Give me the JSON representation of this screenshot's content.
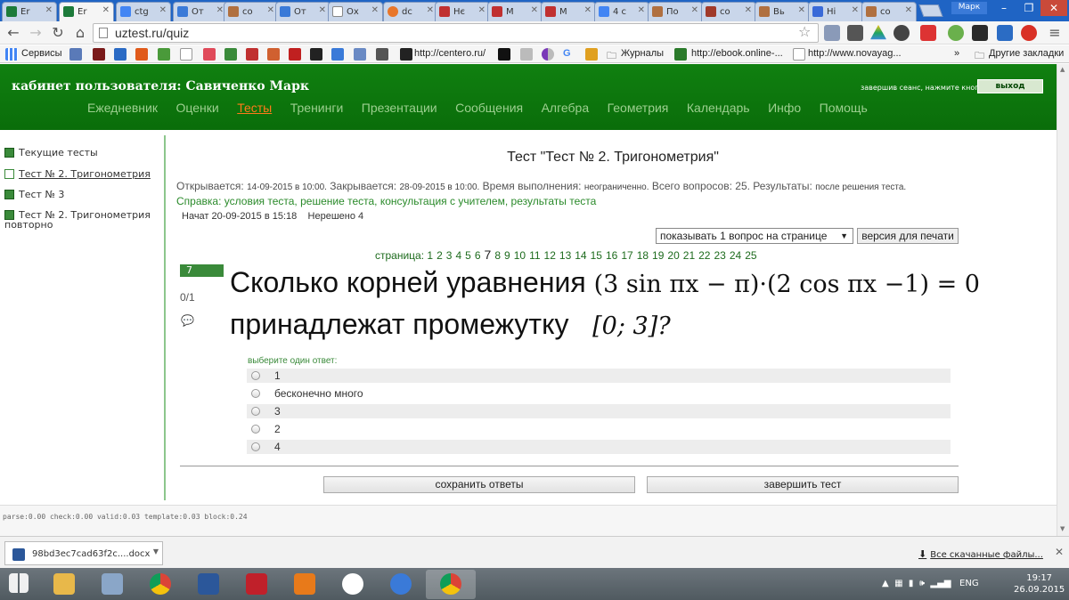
{
  "browser": {
    "tabs": [
      {
        "label": "Er",
        "color": "#1d7b3a",
        "active": false
      },
      {
        "label": "Er",
        "color": "#1d7b3a",
        "active": true
      },
      {
        "label": "ctg",
        "color": "#4285f4",
        "active": false
      },
      {
        "label": "От",
        "color": "#3a7ad8",
        "active": false
      },
      {
        "label": "со",
        "color": "#b07040",
        "active": false
      },
      {
        "label": "От",
        "color": "#3a7ad8",
        "active": false
      },
      {
        "label": "Ох",
        "color": "#888888",
        "active": false
      },
      {
        "label": "dc",
        "color": "#e8762a",
        "active": false
      },
      {
        "label": "Нє",
        "color": "#c03030",
        "active": false
      },
      {
        "label": "М",
        "color": "#c03030",
        "active": false
      },
      {
        "label": "М",
        "color": "#c03030",
        "active": false
      },
      {
        "label": "4 с",
        "color": "#4285f4",
        "active": false
      },
      {
        "label": "По",
        "color": "#b07040",
        "active": false
      },
      {
        "label": "со",
        "color": "#a03a2a",
        "active": false
      },
      {
        "label": "Вь",
        "color": "#b07040",
        "active": false
      },
      {
        "label": "Ні",
        "color": "#3a6ad8",
        "active": false
      },
      {
        "label": "со",
        "color": "#b07040",
        "active": false
      }
    ],
    "profile": "Марк",
    "url": "uztest.ru/quiz",
    "bookmarks": {
      "services": "Сервисы",
      "centero": "http://centero.ru/",
      "journals": "Журналы",
      "ebook": "http://ebook.online-...",
      "novayag": "http://www.novayag...",
      "more": "»",
      "other": "Другие закладки"
    }
  },
  "header": {
    "user_title": "кабинет пользователя: Савиченко Марк",
    "logout_note": "завершив сеанс, нажмите кнопку",
    "logout_button": "выход",
    "menu": [
      "Ежедневник",
      "Оценки",
      "Тесты",
      "Тренинги",
      "Презентации",
      "Сообщения",
      "Алгебра",
      "Геометрия",
      "Календарь",
      "Инфо",
      "Помощь"
    ],
    "active_menu": "Тесты"
  },
  "sidebar": {
    "items": [
      "Текущие тесты",
      "Тест № 2. Тригонометрия",
      "Тест № 3",
      "Тест № 2. Тригонометрия",
      "повторно"
    ]
  },
  "test": {
    "title": "Тест \"Тест № 2. Тригонометрия\"",
    "opens_label": "Открывается:",
    "opens": "14-09-2015 в 10:00.",
    "closes_label": "Закрывается:",
    "closes": "28-09-2015 в 10:00.",
    "duration_label": "Время выполнения:",
    "duration": "неограниченно.",
    "total_label": "Всего вопросов:",
    "total": "25.",
    "results_label": "Результаты:",
    "results": "после решения теста.",
    "help_label": "Справка:",
    "help_links": "условия теста, решение теста, консультация с учителем, результаты теста",
    "started": "Начат 20-09-2015 в 15:18",
    "unsolved": "Нерешено 4",
    "per_page": "показывать 1 вопрос на странице",
    "print_button": "версия для печати",
    "pages_label": "страница:",
    "pages": [
      "1",
      "2",
      "3",
      "4",
      "5",
      "6",
      "7",
      "8",
      "9",
      "10",
      "11",
      "12",
      "13",
      "14",
      "15",
      "16",
      "17",
      "18",
      "19",
      "20",
      "21",
      "22",
      "23",
      "24",
      "25"
    ],
    "current_page": "7"
  },
  "question": {
    "number": "7",
    "score": "0/1",
    "line1_text": "Сколько корней уравнения",
    "equation": "(3 sin πx − π)·(2 cos πx −1) = 0",
    "line2_text": "принадлежат промежутку",
    "interval": "[0; 3]?",
    "choose_label": "выберите один ответ:",
    "options": [
      "1",
      "бесконечно много",
      "3",
      "2",
      "4"
    ]
  },
  "actions": {
    "save": "сохранить ответы",
    "finish": "завершить тест"
  },
  "timing": "parse:0.00   check:0.00   valid:0.03   template:0.03   block:0.24",
  "downloads": {
    "file": "98bd3ec7cad63f2c....docx",
    "all": "Все скачанные файлы..."
  },
  "taskbar": {
    "lang": "ENG",
    "time": "19:17",
    "date": "26.09.2015"
  },
  "colors": {
    "header_green": "#108010",
    "active_menu": "#ff7a1a",
    "link_green": "#2a8a2a"
  }
}
